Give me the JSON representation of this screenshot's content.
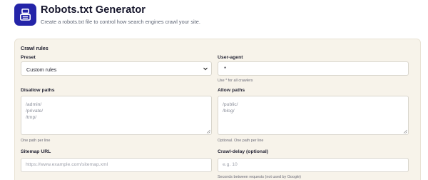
{
  "header": {
    "title": "Robots.txt Generator",
    "subtitle": "Create a robots.txt file to control how search engines crawl your site."
  },
  "panel": {
    "title": "Crawl rules"
  },
  "preset": {
    "label": "Preset",
    "selected": "Custom rules"
  },
  "user_agent": {
    "label": "User-agent",
    "value": "*",
    "hint": "Use * for all crawlers"
  },
  "disallow": {
    "label": "Disallow paths",
    "lines": [
      "/admin/",
      "/private/",
      "/tmp/"
    ],
    "hint": "One path per line"
  },
  "allow": {
    "label": "Allow paths",
    "lines": [
      "/public/",
      "/blog/"
    ],
    "hint": "Optional. One path per line"
  },
  "sitemap": {
    "label": "Sitemap URL",
    "placeholder": "https://www.example.com/sitemap.xml"
  },
  "crawl_delay": {
    "label": "Crawl-delay (optional)",
    "placeholder": "e.g. 10",
    "hint": "Seconds between requests (not used by Google)"
  },
  "colors": {
    "brand": "#2424a8",
    "panel_bg": "#f7f3ea"
  },
  "icons": {
    "logo": "robot-icon",
    "select": "chevron-down-icon",
    "textarea": "resize-handle-icon"
  }
}
